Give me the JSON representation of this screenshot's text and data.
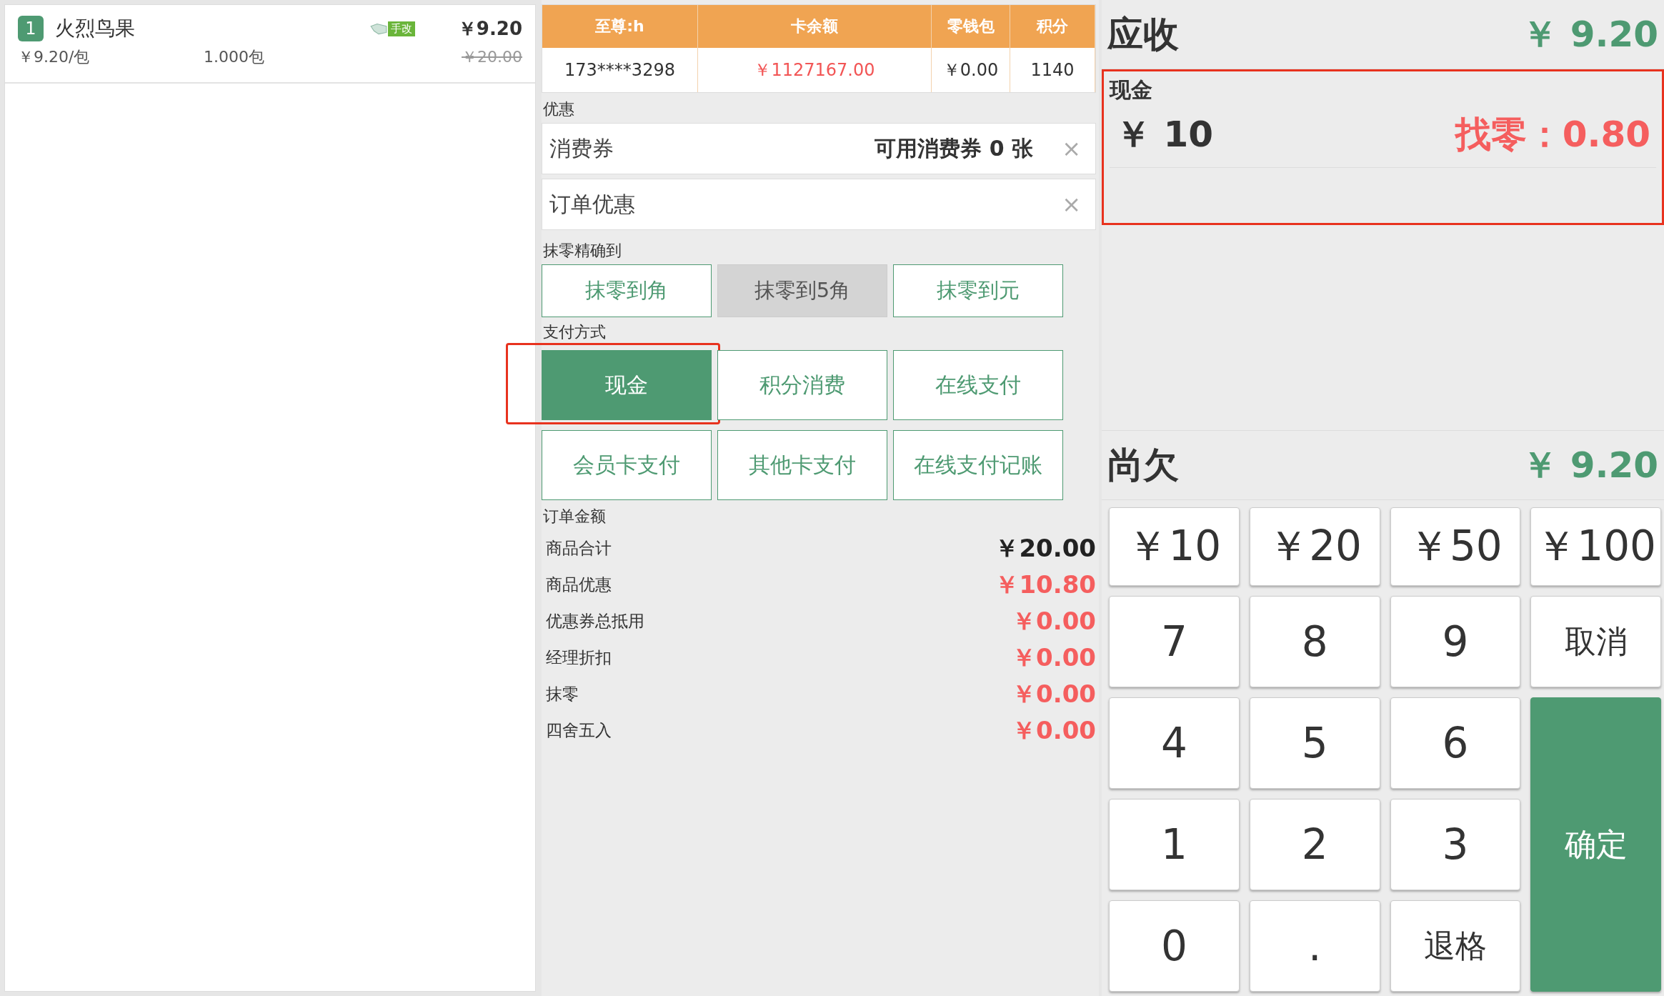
{
  "order_items": [
    {
      "index": "1",
      "name": "火烈鸟果",
      "tag": "手改",
      "price": "￥9.20",
      "unit_price": "￥9.20/包",
      "quantity": "1.000包",
      "original_price": "￥20.00"
    }
  ],
  "member_table": {
    "columns": [
      "至尊:h",
      "卡余额",
      "零钱包",
      "积分"
    ],
    "row": [
      {
        "text": "173****3298",
        "kind": "plain"
      },
      {
        "text": "￥1127167.00",
        "kind": "money"
      },
      {
        "text": "￥0.00",
        "kind": "plain"
      },
      {
        "text": "1140",
        "kind": "plain"
      }
    ]
  },
  "discount": {
    "label": "优惠",
    "rows": [
      {
        "label": "消费券",
        "info": "可用消费券 0 张",
        "clear": "×"
      },
      {
        "label": "订单优惠",
        "clear": "×"
      }
    ]
  },
  "rounding": {
    "label": "抹零精确到",
    "options": [
      {
        "label": "抹零到角",
        "selected": false
      },
      {
        "label": "抹零到5角",
        "selected": true
      },
      {
        "label": "抹零到元",
        "selected": false
      }
    ]
  },
  "payment": {
    "label": "支付方式",
    "methods": [
      {
        "label": "现金",
        "selected": true,
        "highlighted": true
      },
      {
        "label": "积分消费",
        "selected": false,
        "highlighted": false
      },
      {
        "label": "在线支付",
        "selected": false,
        "highlighted": false
      },
      {
        "label": "会员卡支付",
        "selected": false,
        "highlighted": false
      },
      {
        "label": "其他卡支付",
        "selected": false,
        "highlighted": false
      },
      {
        "label": "在线支付记账",
        "selected": false,
        "highlighted": false
      }
    ]
  },
  "order_amount": {
    "label": "订单金额",
    "rows": [
      {
        "label": "商品合计",
        "value": "￥20.00",
        "kind": "total"
      },
      {
        "label": "商品优惠",
        "value": "￥10.80",
        "kind": "deduction"
      },
      {
        "label": "优惠券总抵用",
        "value": "￥0.00",
        "kind": "deduction"
      },
      {
        "label": "经理折扣",
        "value": "￥0.00",
        "kind": "deduction"
      },
      {
        "label": "抹零",
        "value": "￥0.00",
        "kind": "deduction"
      },
      {
        "label": "四舍五入",
        "value": "￥0.00",
        "kind": "deduction"
      }
    ]
  },
  "receivable": {
    "label": "应收",
    "value": "￥ 9.20"
  },
  "cash_panel": {
    "label": "现金",
    "amount": "￥ 10",
    "change": "找零：0.80",
    "highlighted": true
  },
  "outstanding": {
    "label": "尚欠",
    "value": "￥ 9.20"
  },
  "keypad": [
    {
      "label": "￥10",
      "kind": "digit"
    },
    {
      "label": "￥20",
      "kind": "digit"
    },
    {
      "label": "￥50",
      "kind": "digit"
    },
    {
      "label": "￥100",
      "kind": "digit"
    },
    {
      "label": "7",
      "kind": "digit"
    },
    {
      "label": "8",
      "kind": "digit"
    },
    {
      "label": "9",
      "kind": "digit"
    },
    {
      "label": "取消",
      "kind": "action"
    },
    {
      "label": "4",
      "kind": "digit"
    },
    {
      "label": "5",
      "kind": "digit"
    },
    {
      "label": "6",
      "kind": "digit"
    },
    {
      "label": "1",
      "kind": "digit"
    },
    {
      "label": "2",
      "kind": "digit"
    },
    {
      "label": "3",
      "kind": "digit"
    },
    {
      "label": "0",
      "kind": "digit"
    },
    {
      "label": ".",
      "kind": "digit"
    },
    {
      "label": "退格",
      "kind": "action"
    },
    {
      "label": "确定",
      "kind": "confirm"
    }
  ]
}
